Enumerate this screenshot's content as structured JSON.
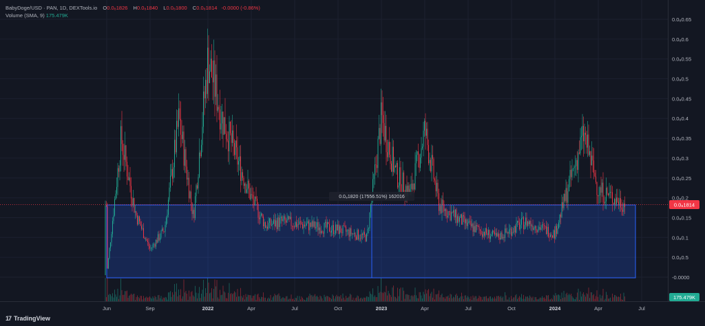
{
  "legend": {
    "symbol": "BabyDoge/USD",
    "source": "· PAN, 1D, DEXTools.io",
    "open_label": "O",
    "open_value": "0.0₈1826",
    "high_label": "H",
    "high_value": "0.0₈1840",
    "low_label": "L",
    "low_value": "0.0₈1800",
    "close_label": "C",
    "close_value": "0.0₈1814",
    "change": "-0.0000 (-0.86%)",
    "volume_label": "Volume (SMA, 9)",
    "volume_value": "175.479K"
  },
  "price_axis": {
    "ticks": [
      "0.65",
      "0.6",
      "0.55",
      "0.5",
      "0.45",
      "0.4",
      "0.35",
      "0.3",
      "0.25",
      "0.2",
      "0.15",
      "0.1",
      "0.5",
      "-0.0000"
    ],
    "ticks_display": [
      "0.0₈0.65",
      "0.0₈0.6",
      "0.0₈0.55",
      "0.0₈0.5",
      "0.0₈0.45",
      "0.0₈0.4",
      "0.0₈0.35",
      "0.0₈0.3",
      "0.0₈0.25",
      "0.0₈0.2",
      "0.0₈0.15",
      "0.0₈0.1",
      "0.0₈0.5",
      "-0.0000"
    ],
    "current_price_label": "0.0₈1814",
    "volume_label": "175.479K"
  },
  "time_axis": {
    "labels": [
      "Jun",
      "Sep",
      "2022",
      "Apr",
      "Jul",
      "Oct",
      "2023",
      "Apr",
      "Jul",
      "Oct",
      "2024",
      "Apr",
      "Jul"
    ]
  },
  "measure_tool": {
    "label": "0.0₈1820 (17556.51%) 162016"
  },
  "branding": {
    "logo_mark": "17",
    "logo_text": "TradingView"
  },
  "colors": {
    "up": "#22ab94",
    "down": "#f23645",
    "measure_fill": "#2962ff",
    "price_line": "#f23645"
  },
  "chart_data": {
    "type": "candlestick",
    "title": "BabyDoge/USD · PAN, 1D, DEXTools.io",
    "price_scale_unit": "0.0₈ (x1e-9)",
    "x_range": [
      "2021-06",
      "2024-07"
    ],
    "approx_close_series": [
      {
        "date": "2021-06",
        "close": 0.005
      },
      {
        "date": "2021-07",
        "close": 0.35
      },
      {
        "date": "2021-08",
        "close": 0.16
      },
      {
        "date": "2021-09",
        "close": 0.07
      },
      {
        "date": "2021-10",
        "close": 0.12
      },
      {
        "date": "2021-11",
        "close": 0.4
      },
      {
        "date": "2021-12",
        "close": 0.15
      },
      {
        "date": "2022-01",
        "close": 0.55
      },
      {
        "date": "2022-02",
        "close": 0.4
      },
      {
        "date": "2022-03",
        "close": 0.3
      },
      {
        "date": "2022-04",
        "close": 0.2
      },
      {
        "date": "2022-05",
        "close": 0.13
      },
      {
        "date": "2022-06",
        "close": 0.14
      },
      {
        "date": "2022-08",
        "close": 0.13
      },
      {
        "date": "2022-10",
        "close": 0.12
      },
      {
        "date": "2022-12",
        "close": 0.1
      },
      {
        "date": "2023-01",
        "close": 0.4
      },
      {
        "date": "2023-02",
        "close": 0.26
      },
      {
        "date": "2023-03",
        "close": 0.21
      },
      {
        "date": "2023-04",
        "close": 0.37
      },
      {
        "date": "2023-05",
        "close": 0.18
      },
      {
        "date": "2023-07",
        "close": 0.13
      },
      {
        "date": "2023-09",
        "close": 0.1
      },
      {
        "date": "2023-11",
        "close": 0.14
      },
      {
        "date": "2024-01",
        "close": 0.11
      },
      {
        "date": "2024-03",
        "close": 0.36
      },
      {
        "date": "2024-04",
        "close": 0.22
      },
      {
        "date": "2024-06",
        "close": 0.1814
      }
    ],
    "measure_range": {
      "from": 0.0,
      "to": 0.182,
      "percent": "17556.51%",
      "bars": "162016"
    },
    "volume_last": "175.479K"
  }
}
